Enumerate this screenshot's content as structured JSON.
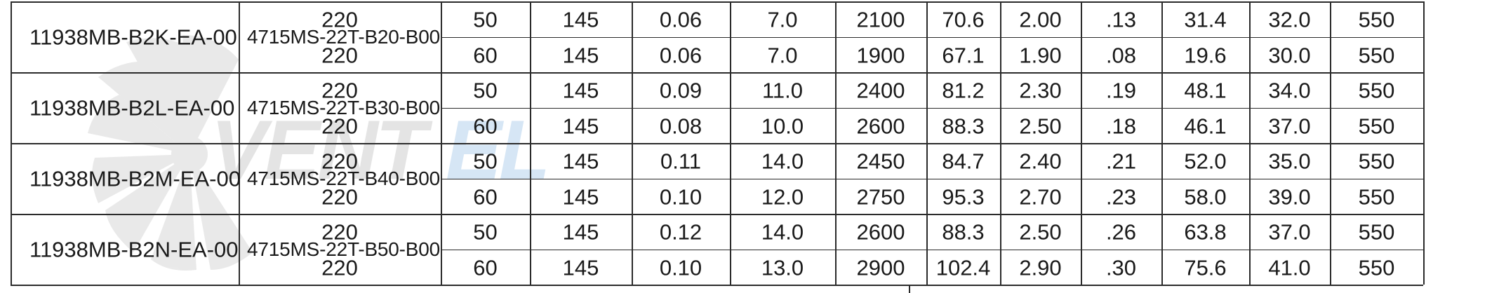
{
  "watermark": {
    "text": "VENTEL"
  },
  "groups": [
    {
      "model": "11938MB-B2K-EA-00",
      "fan": "4715MS-22T-B20-B00",
      "rows": [
        [
          "220",
          "50",
          "145",
          "0.06",
          "7.0",
          "2100",
          "70.6",
          "2.00",
          ".13",
          "31.4",
          "32.0",
          "550"
        ],
        [
          "220",
          "60",
          "145",
          "0.06",
          "7.0",
          "1900",
          "67.1",
          "1.90",
          ".08",
          "19.6",
          "30.0",
          "550"
        ]
      ]
    },
    {
      "model": "11938MB-B2L-EA-00",
      "fan": "4715MS-22T-B30-B00",
      "rows": [
        [
          "220",
          "50",
          "145",
          "0.09",
          "11.0",
          "2400",
          "81.2",
          "2.30",
          ".19",
          "48.1",
          "34.0",
          "550"
        ],
        [
          "220",
          "60",
          "145",
          "0.08",
          "10.0",
          "2600",
          "88.3",
          "2.50",
          ".18",
          "46.1",
          "37.0",
          "550"
        ]
      ]
    },
    {
      "model": "11938MB-B2M-EA-00",
      "fan": "4715MS-22T-B40-B00",
      "rows": [
        [
          "220",
          "50",
          "145",
          "0.11",
          "14.0",
          "2450",
          "84.7",
          "2.40",
          ".21",
          "52.0",
          "35.0",
          "550"
        ],
        [
          "220",
          "60",
          "145",
          "0.10",
          "12.0",
          "2750",
          "95.3",
          "2.70",
          ".23",
          "58.0",
          "39.0",
          "550"
        ]
      ]
    },
    {
      "model": "11938MB-B2N-EA-00",
      "fan": "4715MS-22T-B50-B00",
      "rows": [
        [
          "220",
          "50",
          "145",
          "0.12",
          "14.0",
          "2600",
          "88.3",
          "2.50",
          ".26",
          "63.8",
          "37.0",
          "550"
        ],
        [
          "220",
          "60",
          "145",
          "0.10",
          "13.0",
          "2900",
          "102.4",
          "2.90",
          ".30",
          "75.6",
          "41.0",
          "550"
        ]
      ]
    }
  ]
}
